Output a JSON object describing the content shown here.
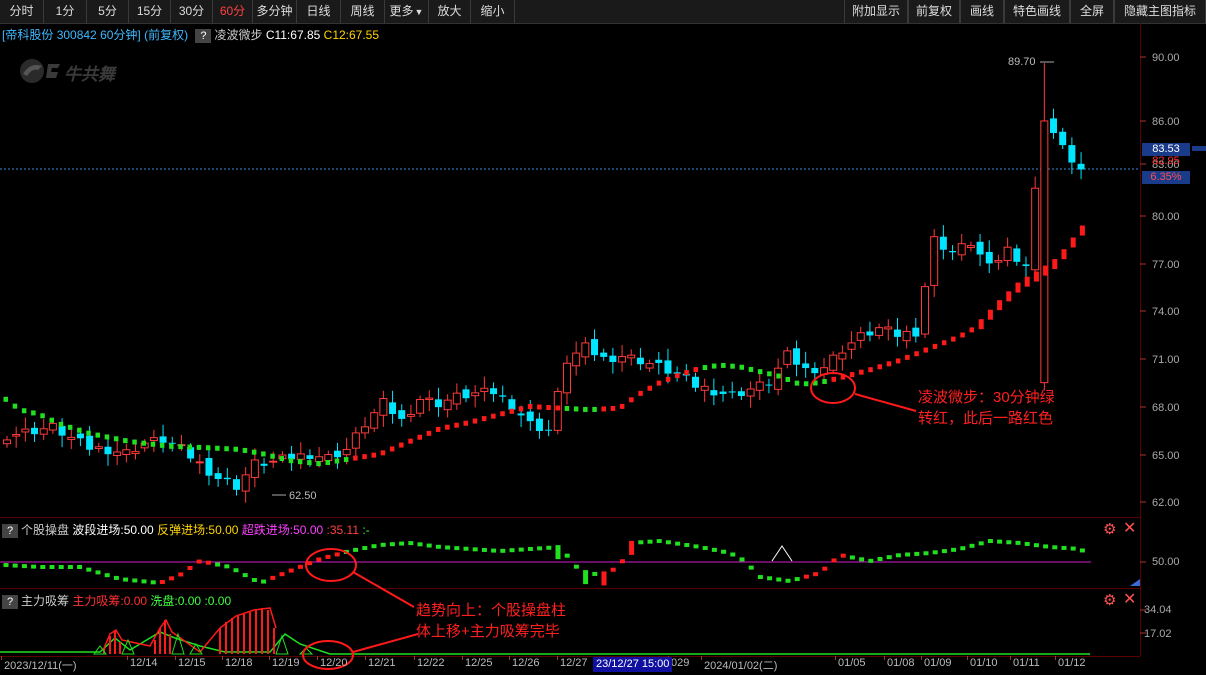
{
  "toolbar": {
    "left": [
      {
        "label": "分时"
      },
      {
        "label": "1分"
      },
      {
        "label": "5分"
      },
      {
        "label": "15分"
      },
      {
        "label": "30分"
      },
      {
        "label": "60分",
        "active": true
      },
      {
        "label": "多分钟"
      },
      {
        "label": "日线"
      },
      {
        "label": "周线"
      },
      {
        "label": "更多"
      },
      {
        "label": "放大"
      },
      {
        "label": "缩小"
      }
    ],
    "right": [
      {
        "label": "附加显示"
      },
      {
        "label": "前复权"
      },
      {
        "label": "画线"
      },
      {
        "label": "特色画线"
      },
      {
        "label": "全屏"
      },
      {
        "label": "隐藏主图指标"
      }
    ]
  },
  "header": {
    "stock": "[帝科股份",
    "code": "300842",
    "period": "60分钟]",
    "adjust": "(前复权)",
    "indicator": "凌波微步",
    "c1": "C11:67.85",
    "c2": "C12:67.55"
  },
  "watermark": "牛共舞",
  "main_axis": {
    "ticks": [
      "90.00",
      "86.00",
      "83.00",
      "80.00",
      "77.00",
      "74.00",
      "71.00",
      "68.00",
      "65.00",
      "62.00"
    ],
    "current_price": "83.53",
    "prev_price": "82.95",
    "change_pct": "6.35%"
  },
  "main_labels": {
    "high": "89.70",
    "low": "62.50"
  },
  "annotations": {
    "a1_line1": "凌波微步：30分钟绿",
    "a1_line2": "转红，此后一路红色",
    "a2_line1": "趋势向上：个股操盘柱",
    "a2_line2": "体上移+主力吸筹完毕"
  },
  "panel2": {
    "name": "个股操盘",
    "v1": "波段进场:50.00",
    "v2": "反弹进场:50.00",
    "v3": "超跌进场:50.00",
    "v4": ":35.11",
    "v5": ":-",
    "tick": "50.00"
  },
  "panel3": {
    "name": "主力吸筹",
    "v1": "主力吸筹:0.00",
    "v2": "洗盘:0.00",
    "v3": ":0.00",
    "tick1": "34.04",
    "tick2": "17.02"
  },
  "dates": {
    "items": [
      "2023/12/11(一)",
      "12/14",
      "12/15",
      "12/18",
      "12/19",
      "12/20",
      "12/21",
      "12/22",
      "12/25",
      "12/26",
      "12/27",
      "029",
      "2024/01/02(二)",
      "01/05",
      "01/08",
      "01/09",
      "01/10",
      "01/11",
      "01/12"
    ],
    "highlight": "23/12/27 15:00"
  },
  "colors": {
    "up": "#ff3030",
    "down": "#00e5e5",
    "bg": "#000000",
    "grid": "#5a0000",
    "accent": "#ff2020"
  }
}
